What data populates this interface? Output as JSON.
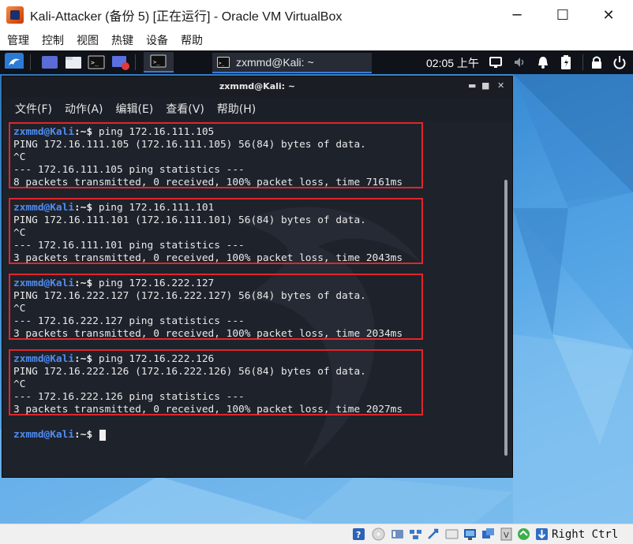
{
  "window": {
    "title": "Kali-Attacker (备份 5) [正在运行] - Oracle VM VirtualBox",
    "minimize_glyph": "─",
    "maximize_glyph": "☐",
    "close_glyph": "✕"
  },
  "host_menu": [
    "管理",
    "控制",
    "视图",
    "热键",
    "设备",
    "帮助"
  ],
  "panel": {
    "task_label": "zxmmd@Kali: ~",
    "clock": "02:05 上午",
    "icons": [
      "kali-menu-icon",
      "workspace-icon",
      "file-manager-icon",
      "terminal-icon",
      "screen-recorder-icon",
      "terminal-icon",
      "display-icon",
      "volume-icon",
      "notification-bell-icon",
      "battery-icon",
      "lock-icon",
      "power-icon"
    ]
  },
  "terminal": {
    "title": "zxmmd@Kali: ~",
    "menu": [
      "文件(F)",
      "动作(A)",
      "编辑(E)",
      "查看(V)",
      "帮助(H)"
    ],
    "prompt_user": "zxmmd@Kali",
    "prompt_suffix": ":~$",
    "blocks": [
      {
        "command": " ping 172.16.111.105",
        "header": "PING 172.16.111.105 (172.16.111.105) 56(84) bytes of data.",
        "interrupt": "^C",
        "stats_title": "--- 172.16.111.105 ping statistics ---",
        "stats": "8 packets transmitted, 0 received, 100% packet loss, time 7161ms"
      },
      {
        "command": " ping 172.16.111.101",
        "header": "PING 172.16.111.101 (172.16.111.101) 56(84) bytes of data.",
        "interrupt": "^C",
        "stats_title": "--- 172.16.111.101 ping statistics ---",
        "stats": "3 packets transmitted, 0 received, 100% packet loss, time 2043ms"
      },
      {
        "command": " ping 172.16.222.127",
        "header": "PING 172.16.222.127 (172.16.222.127) 56(84) bytes of data.",
        "interrupt": "^C",
        "stats_title": "--- 172.16.222.127 ping statistics ---",
        "stats": "3 packets transmitted, 0 received, 100% packet loss, time 2034ms"
      },
      {
        "command": " ping 172.16.222.126",
        "header": "PING 172.16.222.126 (172.16.222.126) 56(84) bytes of data.",
        "interrupt": "^C",
        "stats_title": "--- 172.16.222.126 ping statistics ---",
        "stats": "3 packets transmitted, 0 received, 100% packet loss, time 2027ms"
      }
    ],
    "highlight_color": "#e0262b"
  },
  "statusbar": {
    "host_key": "Right Ctrl",
    "icons": [
      "help-icon",
      "optical-drive-icon",
      "audio-icon",
      "network-icon",
      "usb-icon",
      "shared-folders-icon",
      "display-icon",
      "recording-icon",
      "cpu-icon",
      "virtualization-icon",
      "mouse-integration-icon",
      "keyboard-capture-icon"
    ]
  },
  "colors": {
    "prompt_user": "#4f8cf0",
    "terminal_bg": "#1e222b",
    "panel_bg": "#0f1218",
    "desktop": "#3d8fd6"
  }
}
